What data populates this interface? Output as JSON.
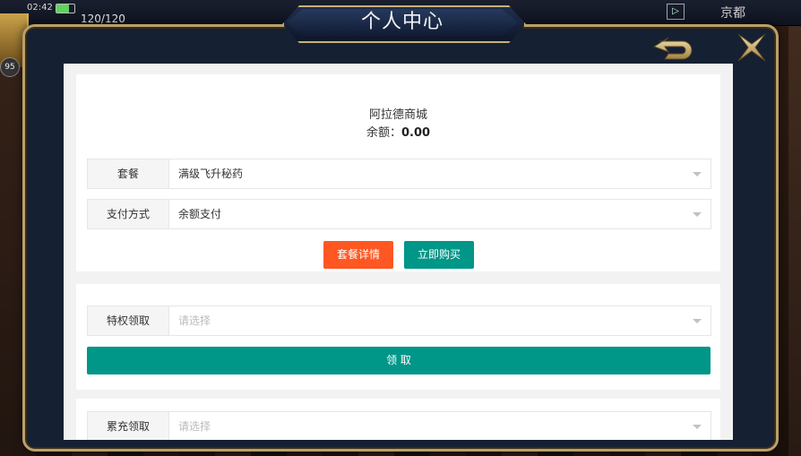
{
  "game": {
    "time": "02:42",
    "energy": "120/120",
    "city": "京都",
    "level": "95"
  },
  "modal": {
    "title": "个人中心"
  },
  "shop": {
    "name": "阿拉德商城",
    "balance_label": "余额：",
    "balance_value": "0.00"
  },
  "package_form": {
    "package_label": "套餐",
    "package_value": "满级飞升秘药",
    "payment_label": "支付方式",
    "payment_value": "余额支付",
    "details_button": "套餐详情",
    "buy_button": "立即购买"
  },
  "privilege_form": {
    "label": "特权领取",
    "placeholder": "请选择",
    "claim_button": "领 取"
  },
  "recharge_form": {
    "label": "累充领取",
    "placeholder": "请选择"
  },
  "colors": {
    "orange_button": "#ff5722",
    "teal_button": "#009688",
    "modal_frame": "#b9a06a",
    "modal_bg": "#152033"
  }
}
